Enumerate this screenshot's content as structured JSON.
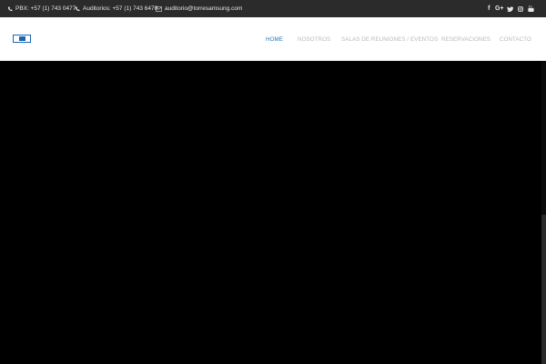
{
  "topbar": {
    "phone_pbx": "PBX: +57 (1) 743 0477",
    "phone_auditorios": "Auditorios: +57 (1) 743 6470",
    "email": "auditorio@torresamsung.com",
    "social": [
      "facebook-icon",
      "google-plus-icon",
      "twitter-icon",
      "instagram-icon",
      "youtube-icon"
    ],
    "background_color": "#2b2b2b"
  },
  "header": {
    "logo_icon": "logo-icon",
    "nav": [
      {
        "label": "HOME",
        "active": true
      },
      {
        "label": "NOSOTROS",
        "active": false
      },
      {
        "label": "SALAS DE REUNIONES / EVENTOS",
        "active": false
      },
      {
        "label": "RESERVACIONES",
        "active": false
      },
      {
        "label": "CONTACTO",
        "active": false
      }
    ],
    "accent_color": "#1f76c2"
  },
  "hero": {
    "background_color": "#000000"
  }
}
